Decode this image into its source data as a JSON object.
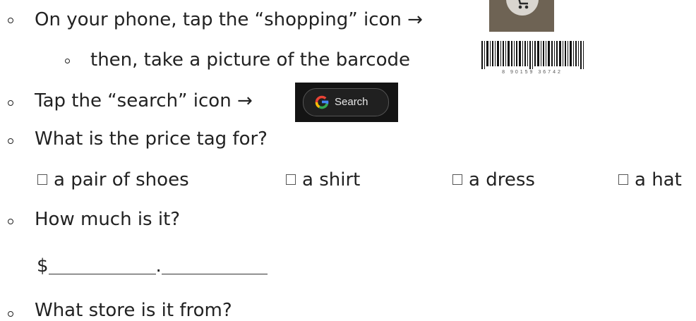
{
  "items": {
    "shopping": "On your phone, tap the “shopping” icon →",
    "barcode": "then, take a picture of the barcode",
    "search": "Tap the “search” icon →",
    "price_tag": "What is the price tag for?",
    "how_much": "How much is it?",
    "store": "What store is it from?"
  },
  "search_chip": {
    "label": "Search",
    "icon": "google-g-icon"
  },
  "shopping_icon": {
    "icon": "shopping-cart-icon"
  },
  "barcode_image": {
    "digits": "8 90159 36742"
  },
  "options": [
    "a pair of shoes",
    "a shirt",
    "a dress",
    "a hat"
  ],
  "price": {
    "currency": "$",
    "separator": "."
  }
}
